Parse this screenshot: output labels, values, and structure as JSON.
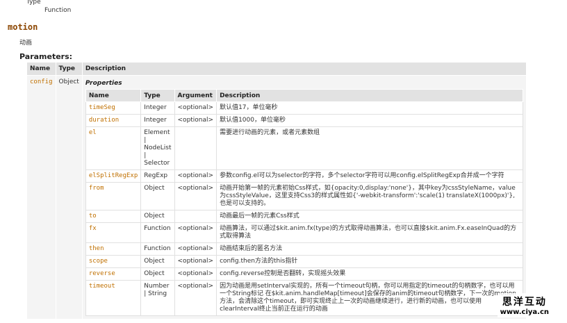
{
  "type_label": "Type",
  "type_value": "Function",
  "method": {
    "name": "motion",
    "description": "动画"
  },
  "params_title": "Parameters:",
  "outer_headers": [
    "Name",
    "Type",
    "Description"
  ],
  "param": {
    "name": "config",
    "type": "Object"
  },
  "properties_title": "Properties",
  "inner_headers": [
    "Name",
    "Type",
    "Argument",
    "Description"
  ],
  "properties": [
    {
      "name": "timeSeg",
      "type": "Integer",
      "argument": "<optional>",
      "description": "默认值17，单位毫秒"
    },
    {
      "name": "duration",
      "type": "Integer",
      "argument": "<optional>",
      "description": "默认值1000，单位毫秒"
    },
    {
      "name": "el",
      "type": "Element | NodeList | Selector",
      "argument": "",
      "description": "需要进行动画的元素，或者元素数组"
    },
    {
      "name": "elSplitRegExp",
      "type": "RegExp",
      "argument": "<optional>",
      "description": "参数config.el可以为selector的字符，多个selector字符可以用config.elSplitRegExp合并成一个字符"
    },
    {
      "name": "from",
      "type": "Object",
      "argument": "<optional>",
      "description": "动画开始第一帧的元素初始Css样式，如{opacity:0,display:'none'}，其中key为cssStyleName，value为cssStyleValue，这里支持Css3的样式属性如{'-webkit-transform':'scale(1) translateX(1000px)'},也是可以支持的。"
    },
    {
      "name": "to",
      "type": "Object",
      "argument": "",
      "description": "动画最后一帧的元素Css样式"
    },
    {
      "name": "fx",
      "type": "Function",
      "argument": "<optional>",
      "description": "动画算法，可以通过$kit.anim.fx(type)的方式取得动画算法，也可以直接$kit.anim.Fx.easeInQuad的方式取得算法"
    },
    {
      "name": "then",
      "type": "Function",
      "argument": "<optional>",
      "description": "动画结束后的匿名方法"
    },
    {
      "name": "scope",
      "type": "Object",
      "argument": "<optional>",
      "description": "config.then方法的this指针"
    },
    {
      "name": "reverse",
      "type": "Object",
      "argument": "<optional>",
      "description": "config.reverse控制是否翻转，实现摇头效果"
    },
    {
      "name": "timeout",
      "type": "Number | String",
      "argument": "<optional>",
      "description": "因为动画是用setInterval实现的，所有一个timeout句柄，你可以用指定的timeout的句柄数字，也可以用一个String标记 在$kit.anim.handleMap[timeout]会保存的anim的timeout句柄数字，下一次的motion方法，会清除这个timeout，即可实现终止上一次的动画继续进行，进行新的动画，也可以使用 clearInterval终止当前正在运行的动画"
    }
  ],
  "watermark": {
    "text": "思洋互动",
    "url": "www.ciya.cn"
  }
}
